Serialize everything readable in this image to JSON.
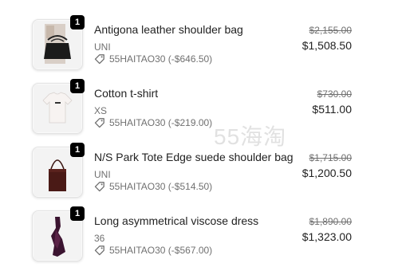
{
  "items": [
    {
      "qty": "1",
      "name": "Antigona leather shoulder bag",
      "variant": "UNI",
      "discount": "55HAITAO30 (-$646.50)",
      "orig_price": "$2,155.00",
      "price": "$1,508.50",
      "thumb_icon": "black-handbag-on-person-image"
    },
    {
      "qty": "1",
      "name": "Cotton t-shirt",
      "variant": "XS",
      "discount": "55HAITAO30 (-$219.00)",
      "orig_price": "$730.00",
      "price": "$511.00",
      "thumb_icon": "white-tshirt-image"
    },
    {
      "qty": "1",
      "name": "N/S Park Tote Edge suede shoulder bag",
      "variant": "UNI",
      "discount": "55HAITAO30 (-$514.50)",
      "orig_price": "$1,715.00",
      "price": "$1,200.50",
      "thumb_icon": "brown-tote-bag-image"
    },
    {
      "qty": "1",
      "name": "Long asymmetrical viscose dress",
      "variant": "36",
      "discount": "55HAITAO30 (-$567.00)",
      "orig_price": "$1,890.00",
      "price": "$1,323.00",
      "thumb_icon": "dark-dress-image"
    }
  ],
  "watermark": "55海淘",
  "colors": {
    "text": "#222222",
    "muted": "#707070",
    "badge": "#000000"
  }
}
